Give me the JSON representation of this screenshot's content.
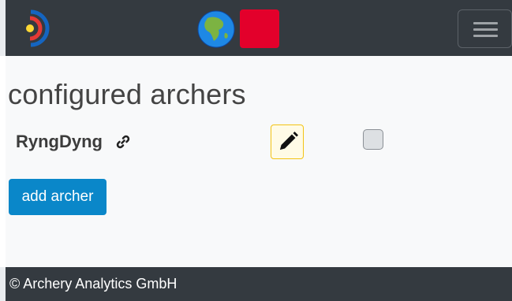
{
  "navbar": {
    "logo_icon": "archery-target-logo-icon",
    "language_icon": "globe-icon",
    "flag_icon": "red-flag-icon",
    "menu_icon": "hamburger-menu-icon"
  },
  "main": {
    "title": "configured archers",
    "archers": [
      {
        "name": "RyngDyng",
        "link_icon": "link-icon",
        "edit_icon": "pencil-icon",
        "checked": false
      }
    ],
    "add_label": "add archer"
  },
  "footer": {
    "text": "© Archery Analytics GmbH"
  },
  "colors": {
    "navbar_bg": "#343a40",
    "primary": "#0a87c9",
    "warning": "#f3c313",
    "flag_red": "#e3002b"
  }
}
